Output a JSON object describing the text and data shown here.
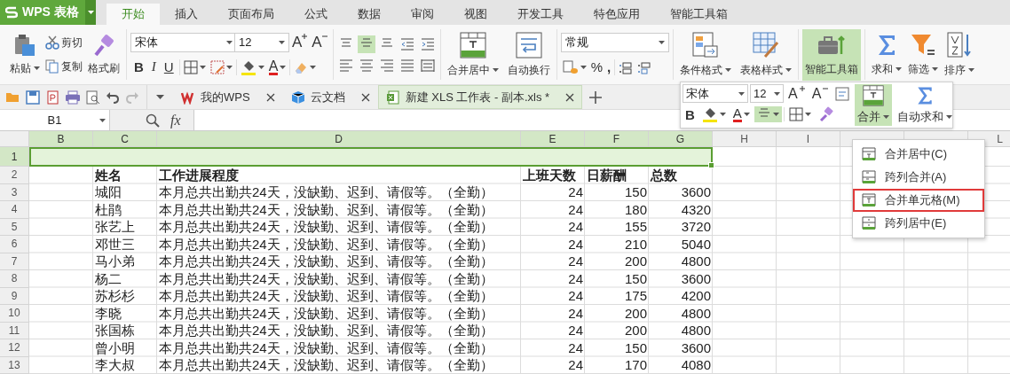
{
  "app_button": {
    "label": "WPS 表格"
  },
  "menu_tabs": [
    {
      "label": "开始",
      "selected": true
    },
    {
      "label": "插入",
      "selected": false
    },
    {
      "label": "页面布局",
      "selected": false
    },
    {
      "label": "公式",
      "selected": false
    },
    {
      "label": "数据",
      "selected": false
    },
    {
      "label": "审阅",
      "selected": false
    },
    {
      "label": "视图",
      "selected": false
    },
    {
      "label": "开发工具",
      "selected": false
    },
    {
      "label": "特色应用",
      "selected": false
    },
    {
      "label": "智能工具箱",
      "selected": false
    }
  ],
  "ribbon": {
    "paste": "粘贴",
    "cut": "剪切",
    "copy": "复制",
    "format_painter": "格式刷",
    "font_name": "宋体",
    "font_size": "12",
    "grow_font": "A",
    "shrink_font": "A",
    "style_buttons": [
      {
        "label": "B",
        "kind": "bold"
      },
      {
        "label": "I",
        "kind": "italic"
      },
      {
        "label": "U",
        "kind": "underline"
      }
    ],
    "font_color": "A",
    "alignment": [
      {
        "kind": "top",
        "selected": false
      },
      {
        "kind": "middle",
        "selected": true
      },
      {
        "kind": "bottom",
        "selected": false
      },
      {
        "kind": "outdent",
        "selected": false
      },
      {
        "kind": "indent",
        "selected": false
      },
      {
        "kind": "left",
        "selected": false
      },
      {
        "kind": "center",
        "selected": false
      },
      {
        "kind": "right",
        "selected": false
      },
      {
        "kind": "justify",
        "selected": false
      },
      {
        "kind": "distributed",
        "selected": false
      }
    ],
    "cell_buttons": [
      {
        "kind": "merge",
        "label": "合并居中",
        "dropdown": true
      },
      {
        "kind": "wrap",
        "label": "自动换行",
        "dropdown": false
      }
    ],
    "number_format": "常规",
    "percent": "%",
    "comma": ",",
    "style_tools": [
      {
        "kind": "conditional",
        "label": "条件格式",
        "dropdown": true
      },
      {
        "kind": "table-style",
        "label": "表格样式",
        "dropdown": true
      }
    ],
    "toolbox": {
      "label": "智能工具箱",
      "highlighted": true
    },
    "data_tools": [
      {
        "kind": "sum",
        "label": "求和",
        "dropdown": true
      },
      {
        "kind": "filter",
        "label": "筛选",
        "dropdown": true
      },
      {
        "kind": "sort",
        "label": "排序",
        "dropdown": true
      }
    ]
  },
  "doc_tabs": [
    {
      "kind": "wps",
      "label": "我的WPS",
      "selected": false
    },
    {
      "kind": "cloud",
      "label": "云文档",
      "selected": false
    },
    {
      "kind": "sheet",
      "label": "新建 XLS 工作表 - 副本.xls *",
      "selected": true
    }
  ],
  "formula_bar": {
    "cell_name": "B1",
    "fx": "fx"
  },
  "sheet": {
    "columns": [
      {
        "label": "B",
        "selected": true
      },
      {
        "label": "C",
        "selected": true
      },
      {
        "label": "D",
        "selected": true
      },
      {
        "label": "E",
        "selected": true
      },
      {
        "label": "F",
        "selected": true
      },
      {
        "label": "G",
        "selected": true
      },
      {
        "label": "H",
        "selected": false
      },
      {
        "label": "I",
        "selected": false
      },
      {
        "selected": false
      },
      {
        "selected": false
      },
      {
        "label": "L",
        "selected": false
      }
    ],
    "rows": [
      {
        "number": "1",
        "selected": true
      },
      {
        "number": "2",
        "kind": "header",
        "selected": false,
        "cells": {
          "C": "姓名",
          "D": "工作进展程度",
          "E": "上班天数",
          "F": "日薪酬",
          "G": "总数"
        }
      },
      {
        "number": "3",
        "kind": "data",
        "selected": false,
        "cells": {
          "C": "城阳",
          "D": "本月总共出勤共24天，没缺勤、迟到、请假等。（全勤）",
          "E": "24",
          "F": "150",
          "G": "3600"
        }
      },
      {
        "number": "4",
        "kind": "data",
        "selected": false,
        "cells": {
          "C": "杜鹃",
          "D": "本月总共出勤共24天，没缺勤、迟到、请假等。（全勤）",
          "E": "24",
          "F": "180",
          "G": "4320"
        }
      },
      {
        "number": "5",
        "kind": "data",
        "selected": false,
        "cells": {
          "C": "张艺上",
          "D": "本月总共出勤共24天，没缺勤、迟到、请假等。（全勤）",
          "E": "24",
          "F": "155",
          "G": "3720"
        }
      },
      {
        "number": "6",
        "kind": "data",
        "selected": false,
        "cells": {
          "C": "邓世三",
          "D": "本月总共出勤共24天，没缺勤、迟到、请假等。（全勤）",
          "E": "24",
          "F": "210",
          "G": "5040"
        }
      },
      {
        "number": "7",
        "kind": "data",
        "selected": false,
        "cells": {
          "C": "马小弟",
          "D": "本月总共出勤共24天，没缺勤、迟到、请假等。（全勤）",
          "E": "24",
          "F": "200",
          "G": "4800"
        }
      },
      {
        "number": "8",
        "kind": "data",
        "selected": false,
        "cells": {
          "C": "杨二",
          "D": "本月总共出勤共24天，没缺勤、迟到、请假等。（全勤）",
          "E": "24",
          "F": "150",
          "G": "3600"
        }
      },
      {
        "number": "9",
        "kind": "data",
        "selected": false,
        "cells": {
          "C": "苏杉杉",
          "D": "本月总共出勤共24天，没缺勤、迟到、请假等。（全勤）",
          "E": "24",
          "F": "175",
          "G": "4200"
        }
      },
      {
        "number": "10",
        "kind": "data",
        "selected": false,
        "cells": {
          "C": "李晓",
          "D": "本月总共出勤共24天，没缺勤、迟到、请假等。（全勤）",
          "E": "24",
          "F": "200",
          "G": "4800"
        }
      },
      {
        "number": "11",
        "kind": "data",
        "selected": false,
        "cells": {
          "C": "张国栋",
          "D": "本月总共出勤共24天，没缺勤、迟到、请假等。（全勤）",
          "E": "24",
          "F": "200",
          "G": "4800"
        }
      },
      {
        "number": "12",
        "kind": "data",
        "selected": false,
        "cells": {
          "C": "曾小明",
          "D": "本月总共出勤共24天，没缺勤、迟到、请假等。（全勤）",
          "E": "24",
          "F": "150",
          "G": "3600"
        }
      },
      {
        "number": "13",
        "kind": "data",
        "selected": false,
        "cells": {
          "C": "李大叔",
          "D": "本月总共出勤共24天，没缺勤、迟到、请假等。（全勤）",
          "E": "24",
          "F": "170",
          "G": "4080"
        }
      }
    ]
  },
  "mini_toolbar": {
    "font_name": "宋体",
    "font_size": "12",
    "grow_font": "A",
    "shrink_font": "A",
    "bold": "B",
    "font_color": "A",
    "align": {
      "selected": true
    },
    "merge": {
      "label": "合并",
      "selected": true
    },
    "auto_sum": "自动求和"
  },
  "merge_menu": [
    {
      "kind": "center",
      "label": "合并居中(C)",
      "selected": false
    },
    {
      "kind": "across",
      "label": "跨列合并(A)",
      "selected": false
    },
    {
      "kind": "cells",
      "label": "合并单元格(M)",
      "selected": true
    },
    {
      "kind": "across-center",
      "label": "跨列居中(E)",
      "selected": false
    }
  ]
}
